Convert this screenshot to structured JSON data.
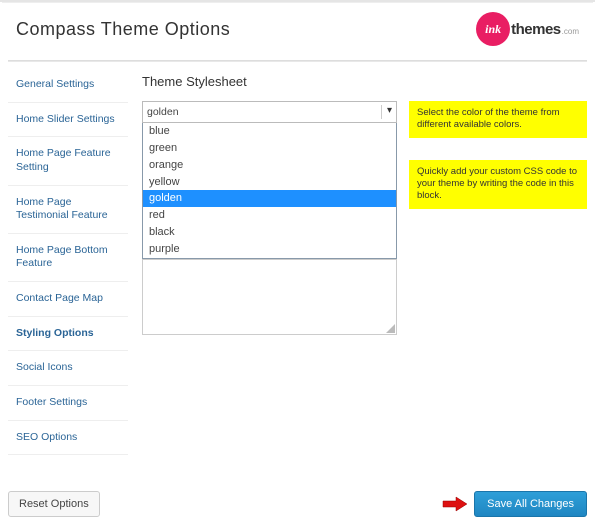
{
  "header": {
    "title": "Compass Theme Options",
    "logo_circle": "ink",
    "logo_main": "themes",
    "logo_suffix": ".com"
  },
  "sidebar": [
    "General Settings",
    "Home Slider Settings",
    "Home Page Feature Setting",
    "Home Page Testimonial Feature",
    "Home Page Bottom Feature",
    "Contact Page Map",
    "Styling Options",
    "Social Icons",
    "Footer Settings",
    "SEO Options"
  ],
  "sidebar_active_index": 6,
  "section_title": "Theme Stylesheet",
  "color_select": {
    "value": "golden"
  },
  "color_options": [
    "blue",
    "green",
    "orange",
    "yellow",
    "golden",
    "red",
    "black",
    "purple"
  ],
  "color_selected_index": 4,
  "notes": {
    "color": "Select the color of the theme from different available colors.",
    "css": "Quickly add your custom CSS code to your theme by writing the code in this block."
  },
  "buttons": {
    "reset": "Reset Options",
    "save": "Save All Changes"
  }
}
